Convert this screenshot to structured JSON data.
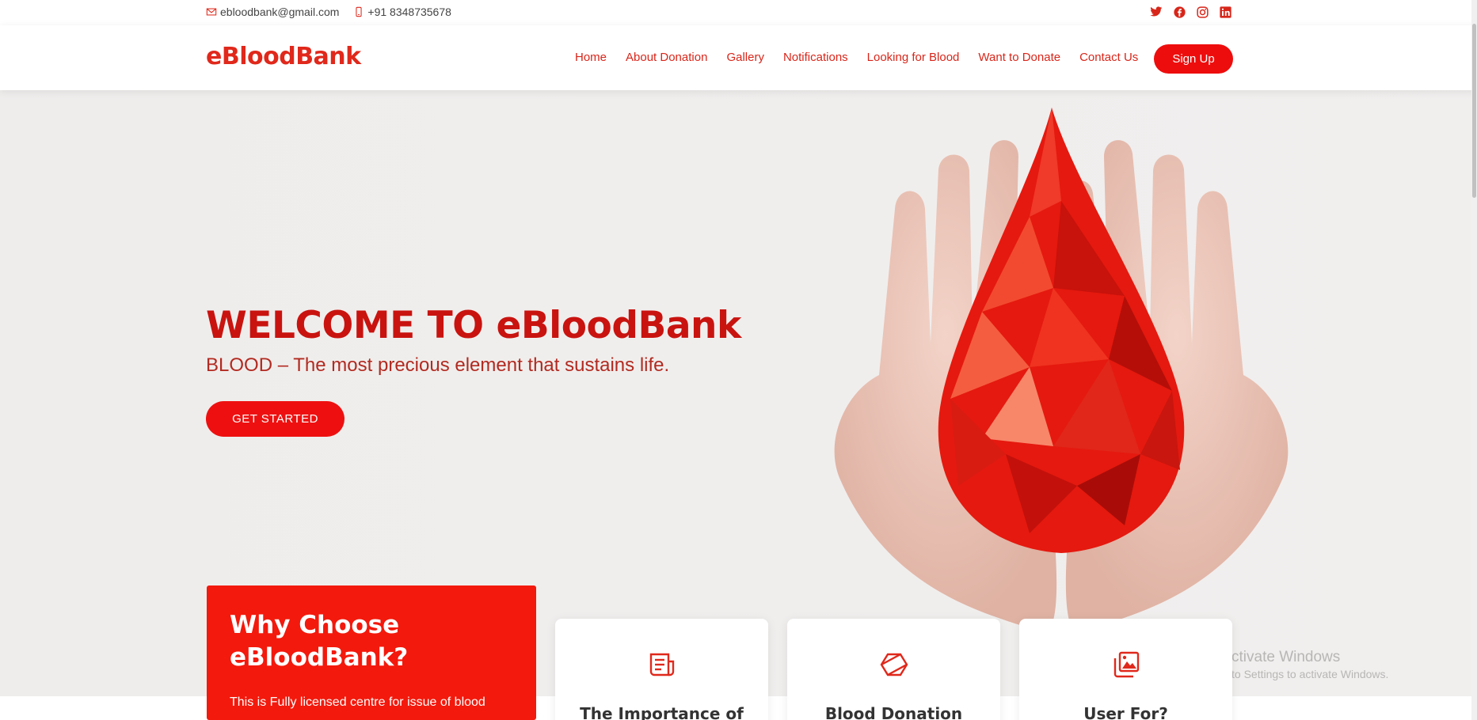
{
  "topbar": {
    "email": "ebloodbank@gmail.com",
    "phone": "+91 8348735678",
    "social_icons": [
      "twitter-icon",
      "facebook-icon",
      "instagram-icon",
      "linkedin-icon"
    ]
  },
  "header": {
    "logo": "eBloodBank",
    "nav": [
      "Home",
      "About Donation",
      "Gallery",
      "Notifications",
      "Looking for Blood",
      "Want to Donate",
      "Contact Us"
    ],
    "signup_label": "Sign Up"
  },
  "hero": {
    "title": "WELCOME TO eBloodBank",
    "subtitle": "BLOOD – The most precious element that sustains life.",
    "cta_label": "GET STARTED"
  },
  "why": {
    "title_line1": "Why Choose",
    "title_line2": "eBloodBank?",
    "text": "This is Fully licensed centre for issue of blood"
  },
  "features": [
    {
      "title": "The Importance of",
      "icon": "document-icon"
    },
    {
      "title": "Blood Donation",
      "icon": "cube-icon"
    },
    {
      "title": "User For?",
      "icon": "images-icon"
    }
  ],
  "watermark": {
    "line1": "ctivate Windows",
    "line2": "to Settings to activate Windows."
  },
  "colors": {
    "brand_red": "#e0281b",
    "button_red": "#ee0d0d",
    "card_red": "#f3190c"
  }
}
